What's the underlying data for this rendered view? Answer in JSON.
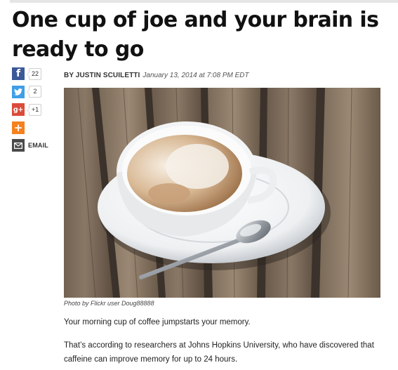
{
  "article": {
    "title": "One cup of joe and your brain is ready to go",
    "author": "BY JUSTIN SCUILETTI",
    "date": "January 13, 2014 at 7:08 PM EDT",
    "photo_caption": "Photo by Flickr user Doug88888",
    "paragraphs": [
      "Your morning cup of coffee jumpstarts your memory.",
      "That’s according to researchers at Johns Hopkins University, who have discovered that caffeine can improve memory for up to 24 hours."
    ]
  },
  "share": {
    "facebook": {
      "icon": "facebook-icon",
      "glyph": "f",
      "count": "22",
      "color": "#3b5998"
    },
    "twitter": {
      "icon": "twitter-bird-icon",
      "count": "2",
      "color": "#3f9ee6"
    },
    "googleplus": {
      "icon": "google-plus-icon",
      "glyph": "g+",
      "count": "+1",
      "color": "#db4b39"
    },
    "addthis": {
      "icon": "plus-icon",
      "glyph": "+",
      "color": "#f5821f"
    },
    "email": {
      "icon": "envelope-icon",
      "label": "EMAIL",
      "color": "#4a4a4a"
    }
  }
}
